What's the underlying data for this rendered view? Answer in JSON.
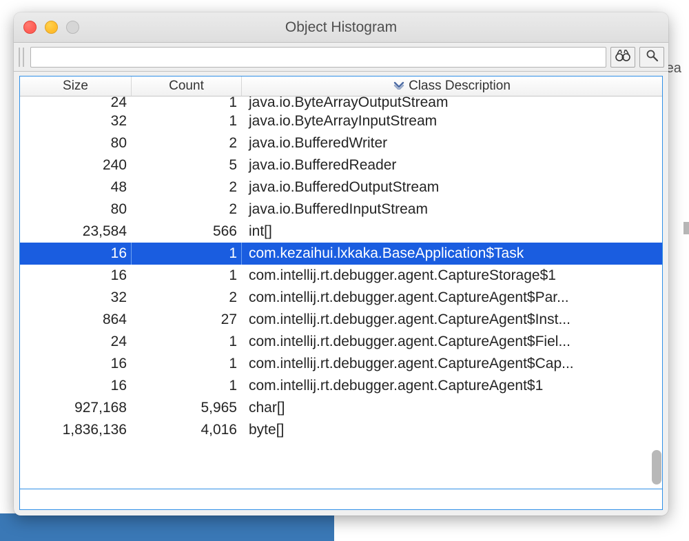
{
  "window": {
    "title": "Object Histogram"
  },
  "toolbar": {
    "search_value": "",
    "search_placeholder": ""
  },
  "obscured": {
    "rea": "rea"
  },
  "columns": {
    "size": "Size",
    "count": "Count",
    "desc": "Class Description"
  },
  "rows": [
    {
      "size": "24",
      "count": "1",
      "desc": "java.io.ByteArrayOutputStream",
      "truncTop": true
    },
    {
      "size": "32",
      "count": "1",
      "desc": "java.io.ByteArrayInputStream"
    },
    {
      "size": "80",
      "count": "2",
      "desc": "java.io.BufferedWriter"
    },
    {
      "size": "240",
      "count": "5",
      "desc": "java.io.BufferedReader"
    },
    {
      "size": "48",
      "count": "2",
      "desc": "java.io.BufferedOutputStream"
    },
    {
      "size": "80",
      "count": "2",
      "desc": "java.io.BufferedInputStream"
    },
    {
      "size": "23,584",
      "count": "566",
      "desc": "int[]"
    },
    {
      "size": "16",
      "count": "1",
      "desc": "com.kezaihui.lxkaka.BaseApplication$Task",
      "selected": true
    },
    {
      "size": "16",
      "count": "1",
      "desc": "com.intellij.rt.debugger.agent.CaptureStorage$1"
    },
    {
      "size": "32",
      "count": "2",
      "desc": "com.intellij.rt.debugger.agent.CaptureAgent$Par..."
    },
    {
      "size": "864",
      "count": "27",
      "desc": "com.intellij.rt.debugger.agent.CaptureAgent$Inst..."
    },
    {
      "size": "24",
      "count": "1",
      "desc": "com.intellij.rt.debugger.agent.CaptureAgent$Fiel..."
    },
    {
      "size": "16",
      "count": "1",
      "desc": "com.intellij.rt.debugger.agent.CaptureAgent$Cap..."
    },
    {
      "size": "16",
      "count": "1",
      "desc": "com.intellij.rt.debugger.agent.CaptureAgent$1"
    },
    {
      "size": "927,168",
      "count": "5,965",
      "desc": "char[]"
    },
    {
      "size": "1,836,136",
      "count": "4,016",
      "desc": "byte[]"
    }
  ]
}
